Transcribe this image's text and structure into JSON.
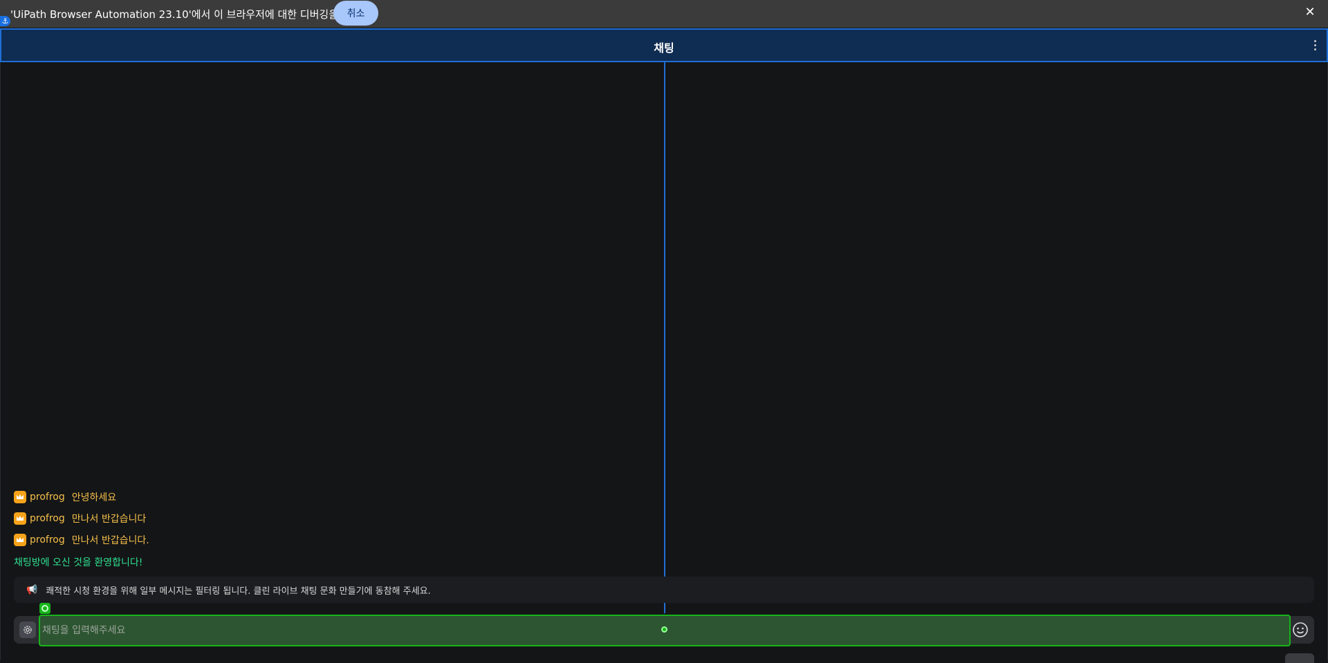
{
  "infobar": {
    "message": "'UiPath Browser Automation 23.10'에서 이 브라우저에 대한 디버깅을 시작함",
    "cancel_label": "취소",
    "close_glyph": "✕",
    "anchor_icon": "anchor-icon"
  },
  "header": {
    "title": "채팅",
    "menu_icon": "kebab-menu-icon"
  },
  "messages": [
    {
      "badge_icon": "crown-icon",
      "user": "profrog",
      "text": "안녕하세요"
    },
    {
      "badge_icon": "crown-icon",
      "user": "profrog",
      "text": "만나서 반갑습니다"
    },
    {
      "badge_icon": "crown-icon",
      "user": "profrog",
      "text": "만나서 반갑습니다."
    }
  ],
  "welcome": "채팅방에 오신 것을 환영합니다!",
  "notice": {
    "icon": "megaphone-icon",
    "text": "쾌적한 시청 환경을 위해 일부 메시지는 필터링 됩니다. 클린 라이브 채팅 문화 만들기에 동참해 주세요."
  },
  "input": {
    "placeholder": "채팅을 입력해주세요",
    "value": "",
    "settings_icon": "gear-icon",
    "emoji_icon": "smiley-icon"
  },
  "colors": {
    "infobar_bg": "#3b3b3b",
    "header_bg": "#0f2c52",
    "highlight_blue": "#1f6fd6",
    "highlight_green": "#17b51b",
    "username": "#f5c04a",
    "welcome": "#2ee08f",
    "cancel_button": "#a8c7fa"
  }
}
